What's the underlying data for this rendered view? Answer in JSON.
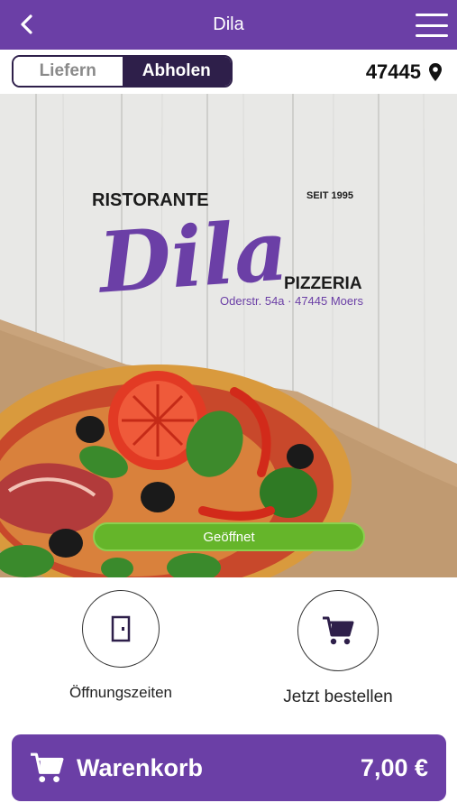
{
  "header": {
    "title": "Dila"
  },
  "mode_toggle": {
    "deliver": "Liefern",
    "pickup": "Abholen",
    "selected": "Abholen"
  },
  "postcode": {
    "value": "47445"
  },
  "hero": {
    "logo_top_left": "RISTORANTE",
    "logo_since": "SEIT 1995",
    "logo_name": "Dila",
    "logo_bottom": "PIZZERIA",
    "logo_address": "Oderstr. 54a · 47445 Moers",
    "status": "Geöffnet"
  },
  "actions": {
    "hours": "Öffnungszeiten",
    "order": "Jetzt bestellen"
  },
  "cart": {
    "label": "Warenkorb",
    "total": "7,00 €"
  },
  "colors": {
    "brand": "#6b3fa6",
    "dark": "#2e1f4a",
    "open": "#65b52a"
  }
}
